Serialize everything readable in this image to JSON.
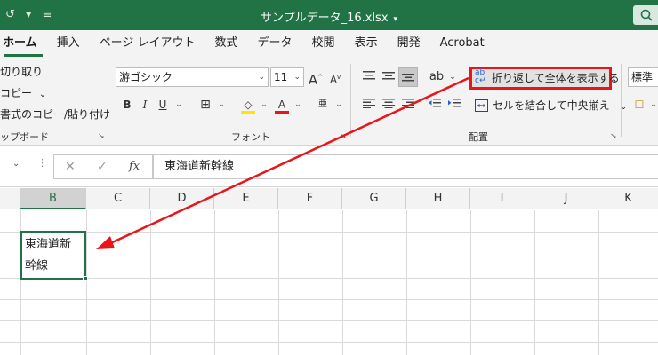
{
  "titlebar": {
    "title": "サンプルデータ_16.xlsx",
    "caret": "▾",
    "quick_access": [
      "↺",
      "▾",
      "≡"
    ],
    "accent": "#217346"
  },
  "tabs": [
    "ホーム",
    "挿入",
    "ページ レイアウト",
    "数式",
    "データ",
    "校閲",
    "表示",
    "開発",
    "Acrobat"
  ],
  "clipboard": {
    "cut": "切り取り",
    "copy": "コピー",
    "copy_caret": "⌄",
    "format_painter": "書式のコピー/貼り付け",
    "label": "ップボード",
    "launcher": "↘"
  },
  "font": {
    "name": "游ゴシック",
    "size": "11",
    "grow": "A",
    "shrink": "A",
    "bold": "B",
    "italic": "I",
    "underline": "U",
    "border": "⊞",
    "fill": "◇",
    "color": "A",
    "phonetic": "亜",
    "label": "フォント",
    "launcher": "↘"
  },
  "alignment": {
    "wrap_text": "折り返して全体を表示する",
    "merge_center": "セルを結合して中央揃え",
    "label": "配置",
    "launcher": "↘",
    "highlight_color": "#e8151b"
  },
  "number": {
    "format": "標準"
  },
  "formula_bar": {
    "cancel": "✕",
    "enter": "✓",
    "fx": "fx",
    "content": "東海道新幹線"
  },
  "grid": {
    "columns": [
      "B",
      "C",
      "D",
      "E",
      "F",
      "G",
      "H",
      "I",
      "J",
      "K"
    ],
    "active_column": "B",
    "active_cell_line1": "東海道新",
    "active_cell_line2": "幹線"
  }
}
